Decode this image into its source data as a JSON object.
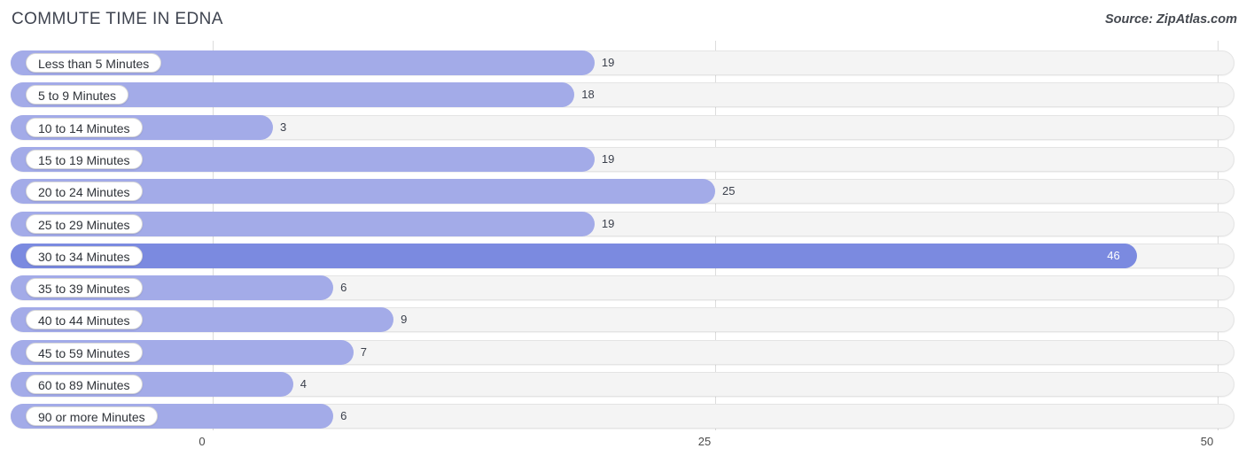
{
  "header": {
    "title": "COMMUTE TIME IN EDNA",
    "source": "Source: ZipAtlas.com"
  },
  "colors": {
    "bar": "#a3abe8",
    "bar_highlight": "#7b8ae0",
    "track": "#f4f4f4",
    "gridline": "#dcdcdc",
    "text": "#3a3f4b"
  },
  "chart_data": {
    "type": "bar",
    "orientation": "horizontal",
    "title": "COMMUTE TIME IN EDNA",
    "xlabel": "",
    "ylabel": "",
    "xlim": [
      0,
      50
    ],
    "ticks": [
      "0",
      "25",
      "50"
    ],
    "tick_values": [
      0,
      25,
      50
    ],
    "grid": true,
    "legend": false,
    "highlight_index": 6,
    "categories": [
      "Less than 5 Minutes",
      "5 to 9 Minutes",
      "10 to 14 Minutes",
      "15 to 19 Minutes",
      "20 to 24 Minutes",
      "25 to 29 Minutes",
      "30 to 34 Minutes",
      "35 to 39 Minutes",
      "40 to 44 Minutes",
      "45 to 59 Minutes",
      "60 to 89 Minutes",
      "90 or more Minutes"
    ],
    "values": [
      19,
      18,
      3,
      19,
      25,
      19,
      46,
      6,
      9,
      7,
      4,
      6
    ],
    "value_labels": [
      "19",
      "18",
      "3",
      "19",
      "25",
      "19",
      "46",
      "6",
      "9",
      "7",
      "4",
      "6"
    ]
  }
}
